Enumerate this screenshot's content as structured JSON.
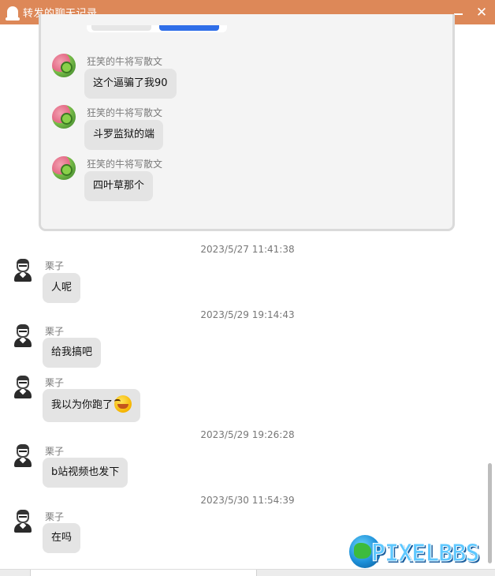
{
  "window": {
    "title": "转发的聊天记录",
    "minimize_icon": "minimize-icon",
    "close_label": "✕"
  },
  "nested_card": {
    "messages": [
      {
        "sender": "狂笑的牛将写散文",
        "text": "这个逼骗了我90"
      },
      {
        "sender": "狂笑的牛将写散文",
        "text": "斗罗监狱的端"
      },
      {
        "sender": "狂笑的牛将写散文",
        "text": "四叶草那个"
      }
    ]
  },
  "timestamps": [
    "2023/5/27 11:41:38",
    "2023/5/29 19:14:43",
    "2023/5/29 19:26:28",
    "2023/5/30 11:54:39"
  ],
  "messages": [
    {
      "sender": "栗子",
      "text": "人呢"
    },
    {
      "sender": "栗子",
      "text": "给我搞吧"
    },
    {
      "sender": "栗子",
      "text": "我以为你跑了"
    },
    {
      "sender": "栗子",
      "text": "b站视频也发下"
    },
    {
      "sender": "栗子",
      "text": "在吗"
    }
  ],
  "watermark": {
    "text": "PIXELBBS"
  },
  "colors": {
    "titlebar": "#dd8858",
    "bubble": "#e4e4e4",
    "nested_bg": "#f4f4f4"
  }
}
